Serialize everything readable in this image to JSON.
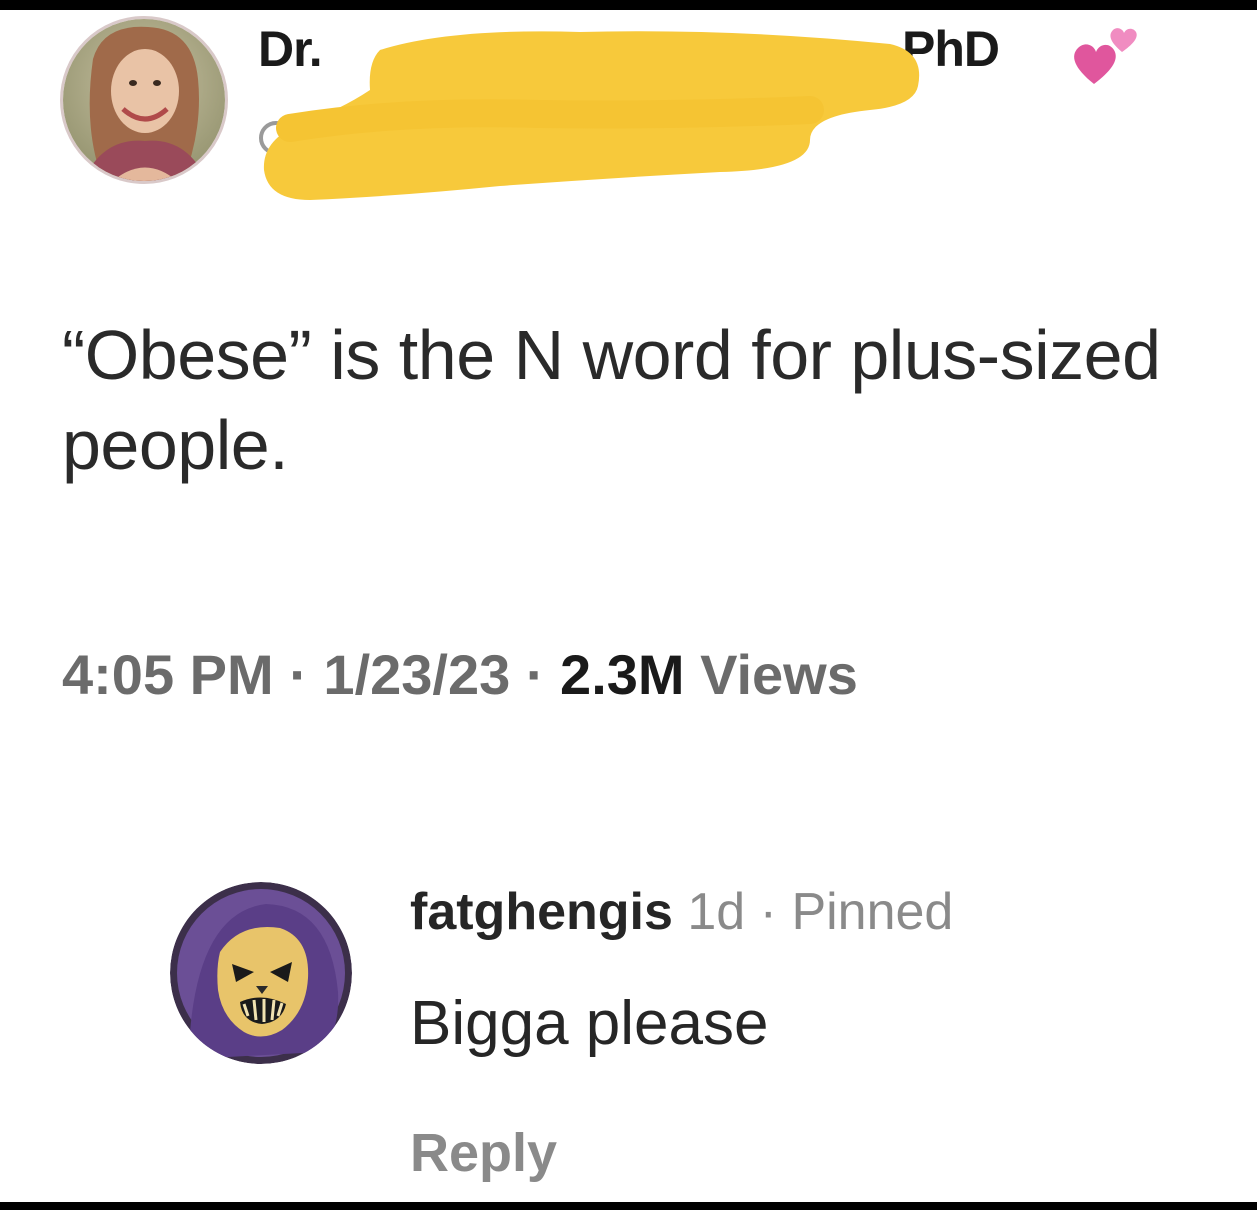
{
  "tweet": {
    "author": {
      "name_prefix": "Dr.",
      "name_suffix": "PhD",
      "avatar_icon": "profile-photo-woman",
      "badge_icon": "two-hearts-emoji",
      "redaction_color": "#f7c93b"
    },
    "text": "“Obese” is the N word for plus-sized people.",
    "meta": {
      "time": "4:05 PM",
      "separator": "·",
      "date": "1/23/23",
      "views_count": "2.3M",
      "views_label": "Views"
    }
  },
  "comment": {
    "avatar_icon": "skeletor-avatar",
    "username": "fatghengis",
    "time": "1d",
    "separator": "·",
    "pinned_label": "Pinned",
    "text": "Bigga please",
    "reply_label": "Reply"
  },
  "colors": {
    "background": "#ffffff",
    "frame": "#000000",
    "text_primary": "#1a1a1a",
    "text_secondary": "#6b6b6b",
    "redaction": "#f7c93b"
  }
}
